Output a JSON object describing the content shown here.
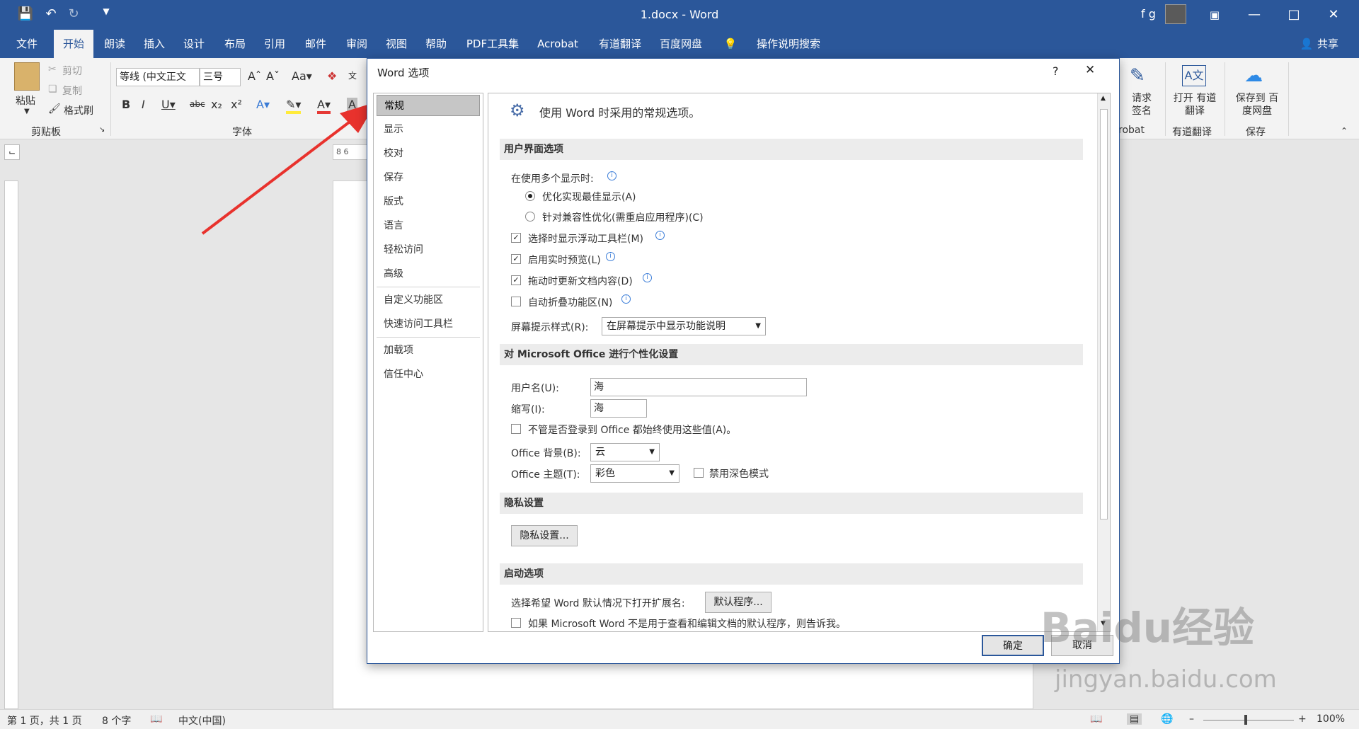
{
  "window": {
    "title": "1.docx - Word",
    "user": "f g",
    "share": "共享"
  },
  "ribbon_tabs": [
    "文件",
    "开始",
    "朗读",
    "插入",
    "设计",
    "布局",
    "引用",
    "邮件",
    "审阅",
    "视图",
    "帮助",
    "PDF工具集",
    "Acrobat",
    "有道翻译",
    "百度网盘"
  ],
  "tell_me": "操作说明搜索",
  "clipboard": {
    "paste": "粘贴",
    "cut": "剪切",
    "copy": "复制",
    "format_painter": "格式刷",
    "group": "剪贴板"
  },
  "font": {
    "name": "等线 (中文正文",
    "size": "三号",
    "group": "字体"
  },
  "right_groups": {
    "sign": "请求 签名",
    "acrobat_group": "robat",
    "open_youdao": "打开 有道翻译",
    "youdao_group": "有道翻译",
    "save_baidu": "保存到 百度网盘",
    "save_group": "保存"
  },
  "ruler": {
    "h_text": "8  6"
  },
  "status": {
    "page": "第 1 页，共 1 页",
    "words": "8 个字",
    "lang": "中文(中国)",
    "zoom": "100%"
  },
  "dialog": {
    "title": "Word 选项",
    "help": "?",
    "close": "✕",
    "nav": [
      "常规",
      "显示",
      "校对",
      "保存",
      "版式",
      "语言",
      "轻松访问",
      "高级",
      "自定义功能区",
      "快速访问工具栏",
      "加载项",
      "信任中心"
    ],
    "nav_selected": 0,
    "heading": "使用 Word 时采用的常规选项。",
    "sections": {
      "ui": "用户界面选项",
      "personalize": "对 Microsoft Office 进行个性化设置",
      "privacy": "隐私设置",
      "startup": "启动选项"
    },
    "multi_display_label": "在使用多个显示时:",
    "radio_best": "优化实现最佳显示(A)",
    "radio_compat": "针对兼容性优化(需重启应用程序)(C)",
    "cb_minitoolbar": "选择时显示浮动工具栏(M)",
    "cb_livepreview": "启用实时预览(L)",
    "cb_dragupdate": "拖动时更新文档内容(D)",
    "cb_collapse": "自动折叠功能区(N)",
    "tooltip_style_label": "屏幕提示样式(R):",
    "tooltip_style_value": "在屏幕提示中显示功能说明",
    "username_label": "用户名(U):",
    "username_value": "海",
    "initials_label": "缩写(I):",
    "initials_value": "海",
    "cb_always_use": "不管是否登录到 Office 都始终使用这些值(A)。",
    "bg_label": "Office 背景(B):",
    "bg_value": "云",
    "theme_label": "Office 主题(T):",
    "theme_value": "彩色",
    "cb_dark": "禁用深色模式",
    "privacy_button": "隐私设置...",
    "ext_label": "选择希望 Word 默认情况下打开扩展名:",
    "default_programs_button": "默认程序...",
    "cb_not_default": "如果 Microsoft Word 不是用于查看和编辑文档的默认程序，则告诉我。",
    "ok": "确定",
    "cancel": "取消"
  },
  "watermark": {
    "brand": "Baidu经验",
    "url": "jingyan.baidu.com"
  },
  "colors": {
    "brand": "#2b579a",
    "annotation_arrow": "#e8322d"
  }
}
